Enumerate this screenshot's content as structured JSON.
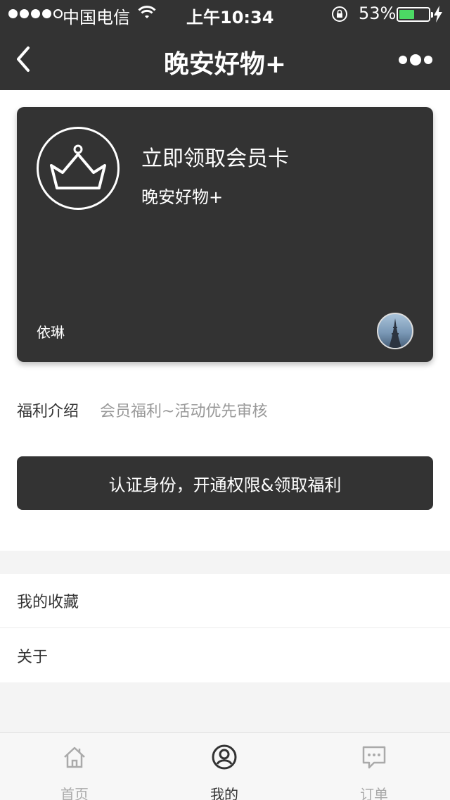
{
  "status_bar": {
    "carrier": "中国电信",
    "time": "上午10:34",
    "battery": "53%",
    "battery_level": 0.53,
    "icons": [
      "signal-dots-icon",
      "wifi-icon",
      "rotation-lock-icon",
      "battery-icon",
      "charging-bolt-icon"
    ]
  },
  "nav": {
    "title": "晚安好物+",
    "icons": [
      "back-chevron-icon",
      "more-dots-icon"
    ]
  },
  "card": {
    "title": "立即领取会员卡",
    "subtitle": "晚安好物+",
    "user_name": "依琳",
    "icons": [
      "crown-icon",
      "avatar-eiffel-tower"
    ]
  },
  "benefit": {
    "label": "福利介绍",
    "value": "会员福利~活动优先审核"
  },
  "cta_label": "认证身份，开通权限&领取福利",
  "menu": [
    "我的收藏",
    "关于"
  ],
  "tabs": [
    {
      "label": "首页",
      "icon": "home-icon",
      "active": false
    },
    {
      "label": "我的",
      "icon": "profile-icon",
      "active": true
    },
    {
      "label": "订单",
      "icon": "chat-bubble-icon",
      "active": false
    }
  ],
  "colors": {
    "dark": "#333333",
    "battery_green": "#4cd964",
    "muted_text": "#999999",
    "background": "#f4f4f4"
  }
}
